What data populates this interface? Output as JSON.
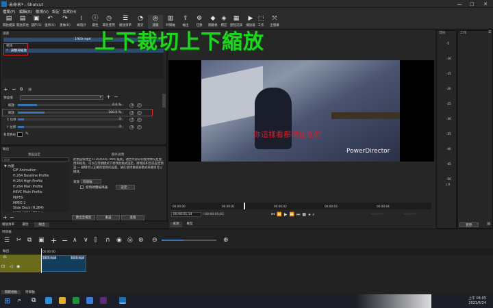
{
  "window": {
    "title": "未命名* - Shotcut",
    "minimize": "—",
    "maximize": "□",
    "close": "✕"
  },
  "menu": [
    "檔案(F)",
    "編輯(E)",
    "檢視(V)",
    "設定",
    "說明(H)"
  ],
  "toolbar": [
    {
      "icon": "open-file-icon",
      "label": "開啟檔案"
    },
    {
      "icon": "open-other-icon",
      "label": "開啟其他"
    },
    {
      "icon": "save-icon",
      "label": "儲存(S)"
    },
    {
      "icon": "undo-icon",
      "label": "復原(U)"
    },
    {
      "icon": "redo-icon",
      "label": "重做(R)"
    },
    {
      "icon": "peak-meter-icon",
      "label": "峰值計"
    },
    {
      "icon": "properties-icon",
      "label": "屬性"
    },
    {
      "icon": "recent-icon",
      "label": "最近使用"
    },
    {
      "icon": "playlist-icon",
      "label": "播放清單"
    },
    {
      "icon": "history-icon",
      "label": "歷史"
    },
    {
      "icon": "filters-icon",
      "label": "濾鏡"
    },
    {
      "icon": "timeline-icon",
      "label": "時間軸"
    },
    {
      "icon": "export-icon",
      "label": "輸出"
    },
    {
      "icon": "jobs-icon",
      "label": "任務"
    },
    {
      "icon": "keyframes-icon",
      "label": "關鍵格"
    },
    {
      "icon": "markers-icon",
      "label": "標記"
    },
    {
      "icon": "notes-icon",
      "label": "歷程記錄"
    },
    {
      "icon": "player-icon",
      "label": "播放器"
    },
    {
      "icon": "layout-icon",
      "label": "工作"
    },
    {
      "icon": "fullscreen-icon",
      "label": "全螢幕"
    }
  ],
  "overlay_text": "上下裁切上下縮放",
  "filters": {
    "header": "濾鏡",
    "clip": "1920.mp4",
    "section": "視訊",
    "item": "調整與縮放",
    "preset_label": "預設值",
    "rows": [
      {
        "label": "縮放",
        "value": "0.0 %"
      },
      {
        "label": "縮放",
        "value": "100.0 %"
      },
      {
        "label": "X 位移",
        "value": "0"
      },
      {
        "label": "Y 位移",
        "value": "0"
      }
    ],
    "bg_label": "背景色彩",
    "scale_fill": 0.25
  },
  "export": {
    "header": "輸出",
    "presets_title": "預設設定",
    "search_placeholder": "搜尋",
    "desc_title": "額外說明",
    "root": "▼ 內建",
    "items": [
      "GIF Animation",
      "H.264 Baseline Profile",
      "H.264 High Profile",
      "H.264 Main Profile",
      "HEVC Main Profile",
      "MJPEG",
      "MPEG-2",
      "Slide Deck (H.264)",
      "Slide Deck (HEVC)"
    ],
    "description": "此預設值建立 H.264/AAC MP4 檔案，適合大部分的使用情況且使用率較高。可以在常規模式下修改此格式設定。將視訊和音訊設定預設 — 解碼可以正確的使用的設置。請在使用後檢查模式來確保可以播放。",
    "from_label": "來源",
    "from_value": "時間軸",
    "hw_label": "使用硬體編碼器",
    "config_btn": "設定...",
    "export_btn": "匯出至檔案",
    "reset_btn": "重設",
    "advanced_btn": "進階"
  },
  "tabs_left": [
    "播放清單",
    "屬性",
    "輸出"
  ],
  "player": {
    "watermark": "PowerDirector",
    "subtitle": "你這樣看都得怪怪的",
    "ruler": [
      "00:00:00",
      "00:00:01",
      "00:00:02",
      "00:00:03",
      "00:00:04"
    ],
    "position": "00:00:01;14",
    "duration": "/ 00:00:05;02",
    "in_out": "--:--:--:--",
    "tabs": [
      "來源",
      "專案"
    ],
    "progress": 0.28
  },
  "meter": {
    "header": "音訊",
    "labels": [
      "-5",
      "-10",
      "-15",
      "-20",
      "-25",
      "-30",
      "-35",
      "-40",
      "-45",
      "-50"
    ],
    "lr": "L  R"
  },
  "work": {
    "header": "工作",
    "pause_btn": "暫停"
  },
  "timeline": {
    "header": "時間軸",
    "master": "輸出",
    "track": "V1",
    "time": "00:00:00",
    "clip1": "1920.mp4",
    "clip2": "1920.mp4",
    "tabs": [
      "關鍵格軸",
      "時間軸"
    ]
  },
  "taskbar": {
    "time": "上午 04:05",
    "date": "2021/6/24",
    "search": "⌕"
  }
}
